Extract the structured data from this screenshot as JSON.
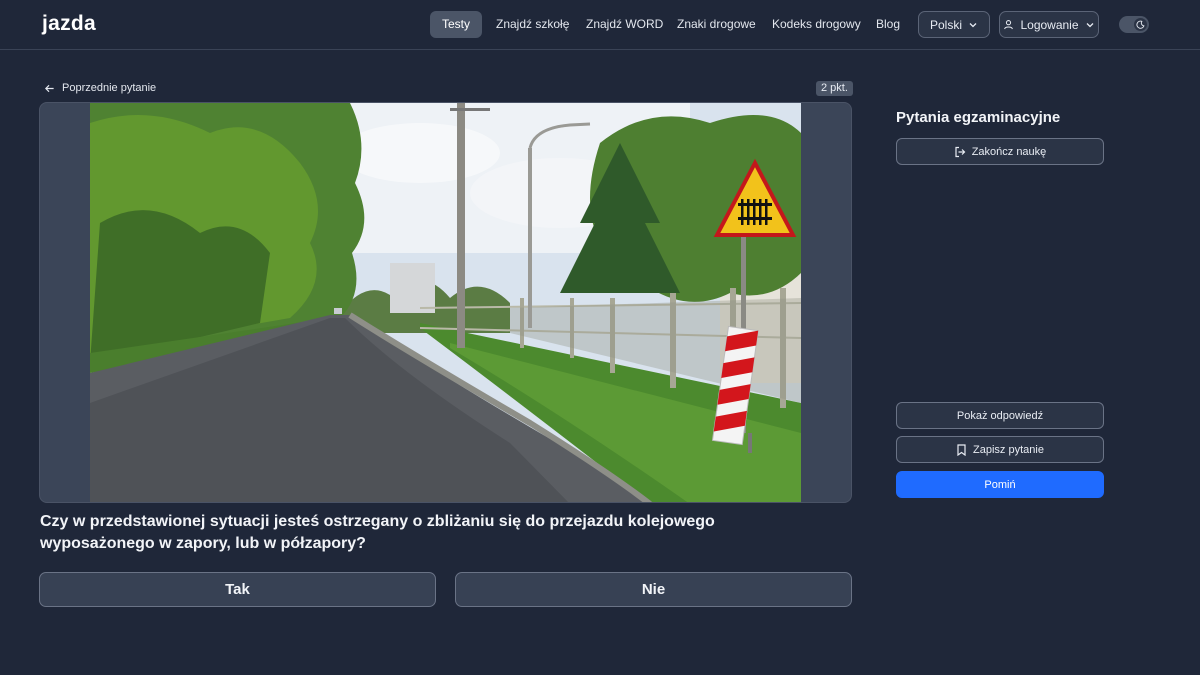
{
  "header": {
    "logo_text": "jazda",
    "nav": [
      {
        "label": "Testy",
        "active": true
      },
      {
        "label": "Znajdź szkołę"
      },
      {
        "label": "Znajdź WORD"
      },
      {
        "label": "Znaki drogowe"
      },
      {
        "label": "Kodeks drogowy"
      },
      {
        "label": "Blog"
      }
    ],
    "language": "Polski",
    "login": "Logowanie",
    "theme_icon": "moon-icon"
  },
  "main": {
    "prev_label": "Poprzednie pytanie",
    "points": "2 pkt.",
    "question": "Czy w przedstawionej sytuacji jesteś ostrzegany o zbliżaniu się do przejazdu kolejowego wyposażonego w zapory, lub w półzapory?",
    "answers": [
      "Tak",
      "Nie"
    ]
  },
  "sidebar": {
    "title": "Pytania egzaminacyjne",
    "finish_label": "Zakończ naukę",
    "show_answer_label": "Pokaż odpowiedź",
    "save_label": "Zapisz pytanie",
    "skip_label": "Pomiń"
  },
  "colors": {
    "background": "#1f2739",
    "accent": "#1f6bff",
    "active_nav": "#4b5567"
  }
}
